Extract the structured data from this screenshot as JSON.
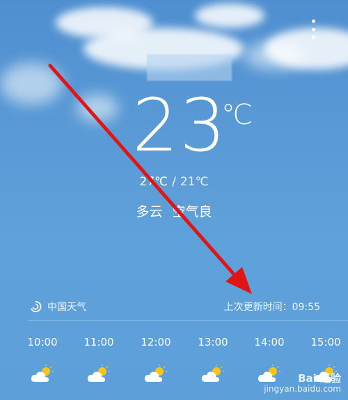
{
  "weather": {
    "temperature": "23",
    "unit": "℃",
    "high": "27℃",
    "low": "21℃",
    "range_sep": "/",
    "condition": "多云",
    "air_quality": "空气良"
  },
  "source": {
    "name": "中国天气",
    "updated": "上次更新时间：09:55"
  },
  "hourly": [
    {
      "time": "10:00",
      "icon": "partly-cloudy-icon"
    },
    {
      "time": "11:00",
      "icon": "partly-cloudy-icon"
    },
    {
      "time": "12:00",
      "icon": "partly-cloudy-icon"
    },
    {
      "time": "13:00",
      "icon": "partly-cloudy-icon"
    },
    {
      "time": "14:00",
      "icon": "partly-cloudy-icon"
    },
    {
      "time": "15:00",
      "icon": "partly-cloudy-icon"
    }
  ],
  "watermark": {
    "brand": "Bai 经验",
    "url": "jingyan.baidu.com"
  },
  "colors": {
    "sky": "#5a9ad6",
    "annotation_arrow": "#e01616",
    "sun": "#f5c518"
  }
}
